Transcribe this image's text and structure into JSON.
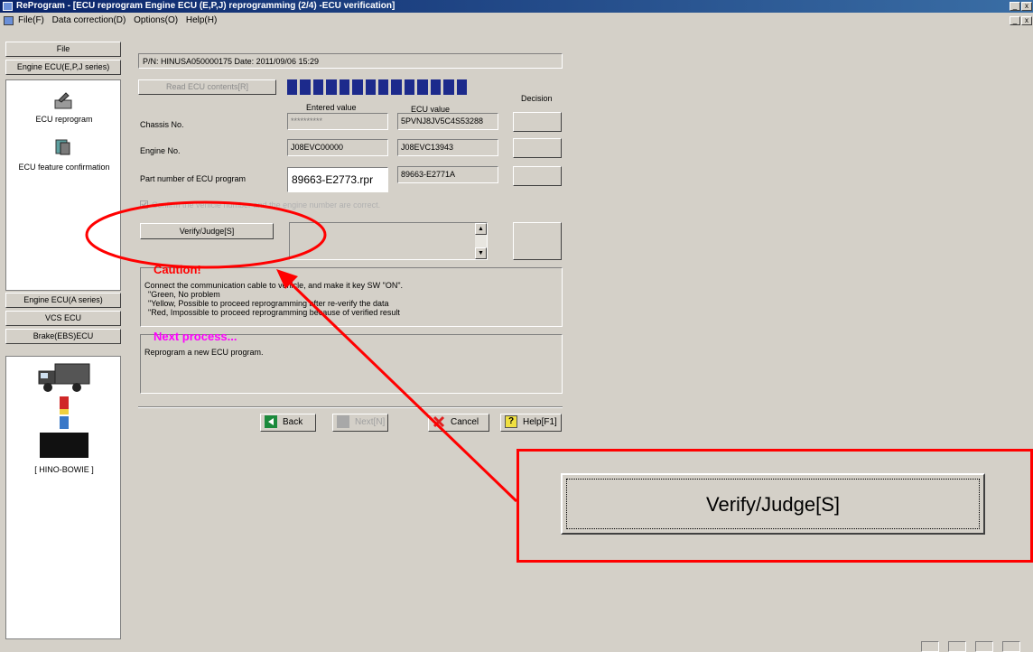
{
  "window": {
    "title": "ReProgram - [ECU reprogram Engine ECU (E,P,J) reprogramming (2/4) -ECU verification]",
    "min_label": "_",
    "close_label": "x"
  },
  "menubar": {
    "items": [
      "File(F)",
      "Data correction(D)",
      "Options(O)",
      "Help(H)"
    ]
  },
  "sidebar": {
    "tab_file": "File",
    "tab_engine_ejp": "Engine ECU(E,P,J series)",
    "item_ecu_reprogram": "ECU reprogram",
    "item_feature_confirmation": "ECU feature confirmation",
    "tab_engine_a": "Engine ECU(A series)",
    "tab_vcs": "VCS ECU",
    "tab_brake": "Brake(EBS)ECU",
    "device_label": "[ HINO-BOWIE ]"
  },
  "main": {
    "info_line": "P/N: HINUSA050000175  Date: 2011/09/06 15:29",
    "read_button": "Read ECU contents[R]",
    "col_entered": "Entered value",
    "col_ecu": "ECU value",
    "col_decision": "Decision",
    "rows": [
      {
        "label": "Chassis No.",
        "entered": "**********",
        "ecu": "5PVNJ8JV5C4S53288"
      },
      {
        "label": "Engine No.",
        "entered": "J08EVC00000",
        "ecu": "J08EVC13943"
      },
      {
        "label": "Part number of ECU program",
        "entered": "89663-E2773.rpr",
        "ecu": "89663-E2771A"
      }
    ],
    "confirm_checkbox": "Confirm the vehicle number and the engine number are correct.",
    "verify_button": "Verify/Judge[S]",
    "caution_title": "Caution!",
    "caution_lines": [
      "Connect the communication cable to vehicle, and make it key SW \"ON\".",
      "\"Green, No problem",
      "\"Yellow, Possible to proceed reprogramming after re-verify the data",
      "\"Red, Impossible to proceed reprogramming because of verified result"
    ],
    "next_title": "Next process...",
    "next_text": "Reprogram a new ECU program.",
    "back_button": "Back",
    "next_button": "Next[N]",
    "cancel_button": "Cancel",
    "help_button": "Help[F1]"
  },
  "zoom": {
    "verify_button": "Verify/Judge[S]"
  },
  "colors": {
    "progress": "#1c2a8c",
    "annotation": "#ff0000",
    "caution": "#ff0000",
    "next_process": "#ff00ff",
    "green_icon": "#1b8a3c"
  },
  "progress": {
    "segments": 14,
    "filled": 14
  }
}
